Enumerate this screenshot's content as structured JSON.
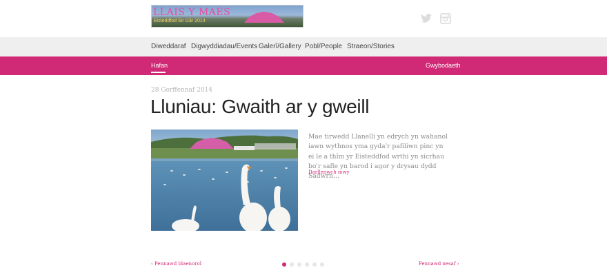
{
  "header": {
    "logo_title": "LLAIS Y MAES",
    "logo_subtitle": "Eisteddfod Sir Gâr 2014",
    "social_icons": [
      "twitter-icon",
      "instagram-icon"
    ]
  },
  "topnav": {
    "items": [
      "Diweddaraf",
      "Digwyddiadau/Events",
      "Galerî/Gallery",
      "Pobl/People",
      "Straeon/Stories"
    ]
  },
  "subnav": {
    "home": "Hafan",
    "info": "Gwybodaeth"
  },
  "article": {
    "date": "28 Gorffennaf 2014",
    "title": "Lluniau: Gwaith ar y gweill",
    "excerpt": "Mae tirwedd Llanelli yn edrych yn wahanol iawn wythnos yma gyda'r pafiliwn pinc yn ei le a thîm yr Eisteddfod wrthi yn sicrhau bo'r safle yn barod i agor y drysau dydd Sadwrn…",
    "read_more": "Darllenwch mwy"
  },
  "pagination": {
    "prev": "‹  Pennawd blaenorol",
    "next": "Pennawd nesaf  ›",
    "total": 6,
    "active_index": 0
  },
  "colors": {
    "accent": "#d02a76",
    "nav_bg": "#efefef",
    "social_grey": "#dddddd"
  }
}
